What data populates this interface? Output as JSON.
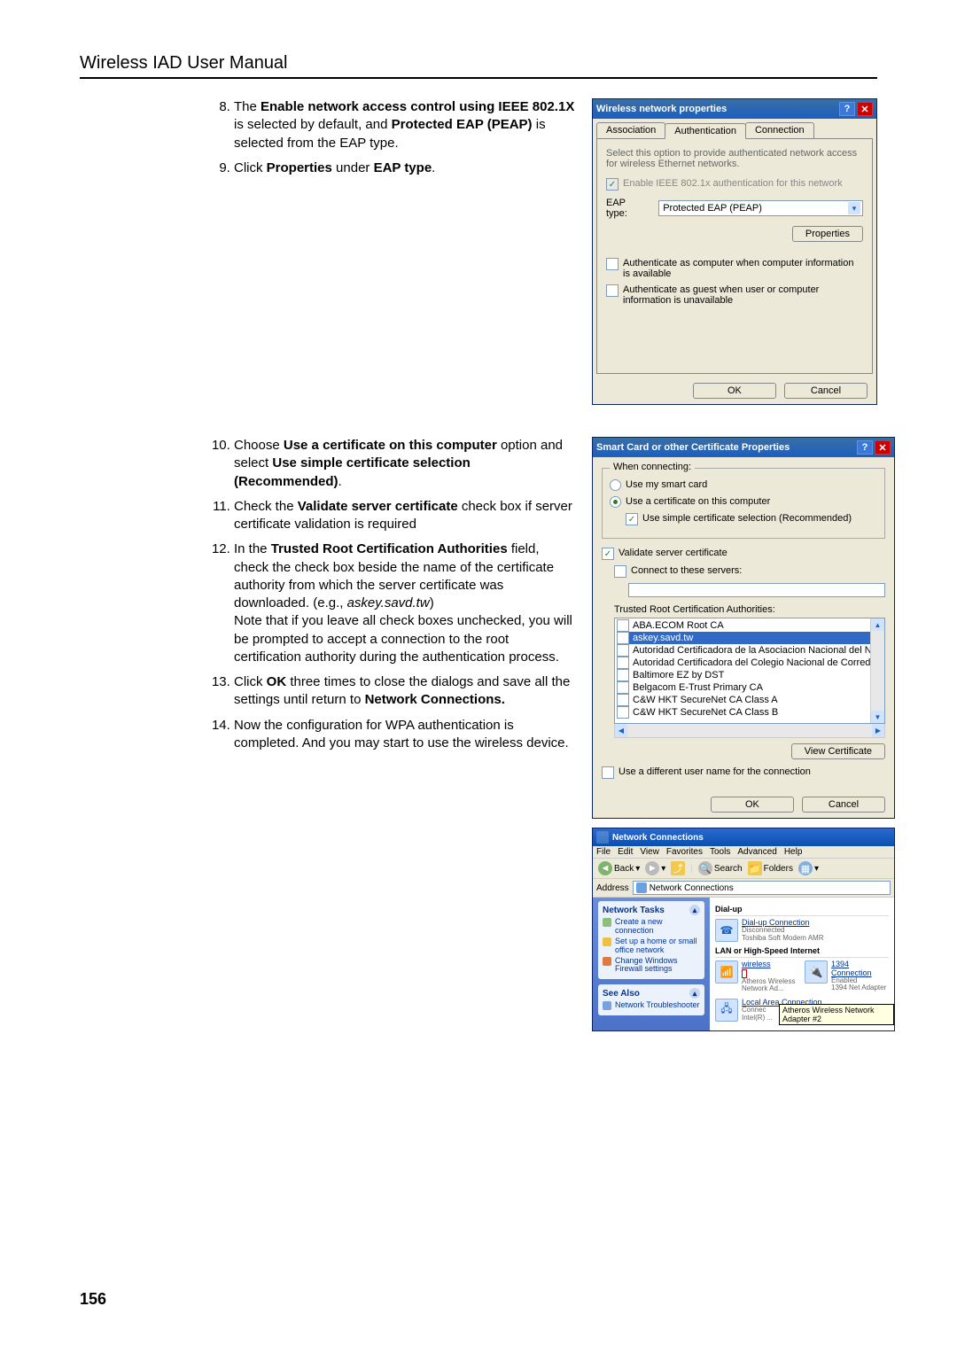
{
  "header": {
    "title": "Wireless IAD User Manual"
  },
  "page_number": "156",
  "instructions": {
    "block1": [
      {
        "num": "8.",
        "html": "The <b>Enable network access control using IEEE 802.1X</b> is selected by default, and <b>Protected EAP (PEAP)</b> is selected from the EAP type."
      },
      {
        "num": "9.",
        "html": "Click <b>Properties</b> under <b>EAP type</b>."
      }
    ],
    "block2": [
      {
        "num": "10.",
        "html": "Choose <b>Use a certificate on this computer</b> option and select <b>Use simple certificate selection (Recommended)</b>."
      },
      {
        "num": "11.",
        "html": "Check the <b>Validate server certificate</b> check box if server certificate validation is required"
      },
      {
        "num": "12.",
        "html": "In the <b>Trusted Root Certification Authorities</b> field, check the check box beside the name of the certificate authority from which the server certificate was downloaded. (e.g., <i>askey.savd.tw</i>)<br>Note that if you leave all check boxes unchecked, you will be prompted to accept a connection to the root certification authority during the authentication process."
      },
      {
        "num": "13.",
        "html": "Click <b>OK</b> three times to close the dialogs and save all the settings until return to <b>Network Connections.</b>"
      },
      {
        "num": "14.",
        "html": "Now the configuration for WPA authentication is completed. And you may start to use the wireless device."
      }
    ]
  },
  "dlg1": {
    "title": "Wireless network properties",
    "tabs": {
      "assoc": "Association",
      "auth": "Authentication",
      "conn": "Connection"
    },
    "desc": "Select this option to provide authenticated network access for wireless Ethernet networks.",
    "enable_8021x": "Enable IEEE 802.1x authentication for this network",
    "eap_type_label": "EAP type:",
    "eap_type_value": "Protected EAP (PEAP)",
    "properties_btn": "Properties",
    "auth_as_computer": "Authenticate as computer when computer information is available",
    "auth_as_guest": "Authenticate as guest when user or computer information is unavailable",
    "ok": "OK",
    "cancel": "Cancel"
  },
  "dlg2": {
    "title": "Smart Card or other Certificate Properties",
    "when_connecting": "When connecting:",
    "use_smart_card": "Use my smart card",
    "use_cert": "Use a certificate on this computer",
    "simple_sel": "Use simple certificate selection (Recommended)",
    "validate_server": "Validate server certificate",
    "connect_servers": "Connect to these servers:",
    "trca_label": "Trusted Root Certification Authorities:",
    "trca_items": [
      "ABA.ECOM Root CA",
      "askey.savd.tw",
      "Autoridad Certificadora de la Asociacion Nacional del Notaria",
      "Autoridad Certificadora del Colegio Nacional de Correduria Pu",
      "Baltimore EZ by DST",
      "Belgacom E-Trust Primary CA",
      "C&W HKT SecureNet CA Class A",
      "C&W HKT SecureNet CA Class B"
    ],
    "view_cert": "View Certificate",
    "diff_user": "Use a different user name for the connection",
    "ok": "OK",
    "cancel": "Cancel"
  },
  "explorer": {
    "title": "Network Connections",
    "menu": [
      "File",
      "Edit",
      "View",
      "Favorites",
      "Tools",
      "Advanced",
      "Help"
    ],
    "toolbar": {
      "back": "Back",
      "search": "Search",
      "folders": "Folders"
    },
    "address_label": "Address",
    "address_value": "Network Connections",
    "side": {
      "tasks_title": "Network Tasks",
      "tasks": [
        "Create a new connection",
        "Set up a home or small office network",
        "Change Windows Firewall settings"
      ],
      "seealso_title": "See Also",
      "seealso": [
        "Network Troubleshooter"
      ]
    },
    "groups": {
      "dialup": "Dial-up",
      "lan": "LAN or High-Speed Internet"
    },
    "dialup_item": {
      "name": "Dial-up Connection",
      "status": "Disconnected",
      "device": "Toshiba Soft Modem AMR"
    },
    "lan_items": {
      "wireless": {
        "name": "wireless",
        "status": "",
        "device": "Atheros Wireless Network Ad..."
      },
      "c1394": {
        "name": "1394 Connection",
        "status": "Enabled",
        "device": "1394 Net Adapter"
      },
      "lac": {
        "name": "Local Area Connection",
        "status": "Connec",
        "device": "Intel(R) ..."
      }
    },
    "tooltip": "Atheros Wireless Network Adapter #2"
  }
}
